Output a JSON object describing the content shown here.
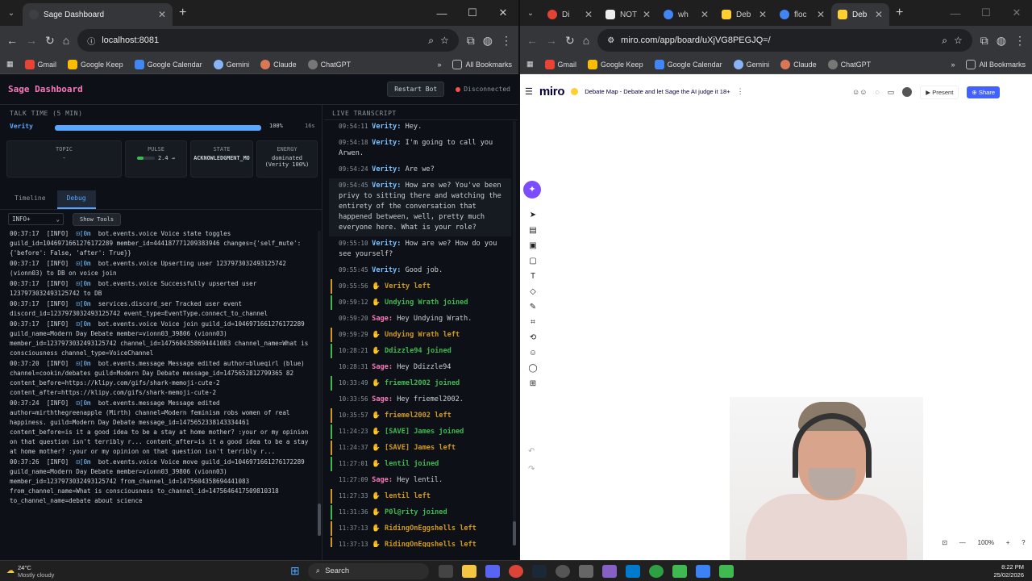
{
  "left_browser": {
    "tab_title": "Sage Dashboard",
    "url": "localhost:8081",
    "bookmarks": [
      "Gmail",
      "Google Keep",
      "Google Calendar",
      "Gemini",
      "Claude",
      "ChatGPT"
    ],
    "all_bookmarks": "All Bookmarks"
  },
  "right_browser": {
    "tabs": [
      "Di",
      "NOT",
      "wh",
      "Deb",
      "floc",
      "Deb"
    ],
    "url": "miro.com/app/board/uXjVG8PEGJQ=/",
    "bookmarks": [
      "Gmail",
      "Google Keep",
      "Google Calendar",
      "Gemini",
      "Claude",
      "ChatGPT"
    ],
    "all_bookmarks": "All Bookmarks"
  },
  "dashboard": {
    "title": "Sage Dashboard",
    "restart_label": "Restart Bot",
    "status": "Disconnected",
    "talk_time_label": "TALK TIME (5 MIN)",
    "talk_speaker": "Verity",
    "talk_percent": "100%",
    "talk_seconds": "16s",
    "talk_fill": 1.0,
    "cards": {
      "topic_label": "TOPIC",
      "topic_value": "-",
      "pulse_label": "PULSE",
      "pulse_value": "2.4 →",
      "state_label": "STATE",
      "state_value": "ACKNOWLEDGMENT_MO",
      "energy_label": "ENERGY",
      "energy_value": "dominated",
      "energy_sub": "(Verity 100%)"
    },
    "tabs": [
      "Timeline",
      "Debug"
    ],
    "filter_value": "INFO+",
    "show_tools": "Show Tools",
    "logs": [
      {
        "time": "00:37:17",
        "level": "[INFO]",
        "mod": "\u001b[0m",
        "msg": "bot.events.voice Voice state toggles guild_id=1046971661276172289 member_id=444187771209383946 changes={'self_mute': {'before': False, 'after': True}}"
      },
      {
        "time": "00:37:17",
        "level": "[INFO]",
        "mod": "\u001b[0m",
        "msg": "bot.events.voice Upserting user 1237973032493125742 (vionn03) to DB on voice join"
      },
      {
        "time": "00:37:17",
        "level": "[INFO]",
        "mod": "\u001b[0m",
        "msg": "bot.events.voice Successfully upserted user 1237973032493125742 to DB"
      },
      {
        "time": "00:37:17",
        "level": "[INFO]",
        "mod": "\u001b[0m",
        "msg": "services.discord_ser Tracked user event discord_id=1237973032493125742 event_type=EventType.connect_to_channel"
      },
      {
        "time": "00:37:17",
        "level": "[INFO]",
        "mod": "\u001b[0m",
        "msg": "bot.events.voice Voice join guild_id=1046971661276172289 guild_name=Modern Day Debate member=vionn03_39806 (vionn03) member_id=1237973032493125742 channel_id=1475604358694441083 channel_name=What is consciousness channel_type=VoiceChannel"
      },
      {
        "time": "00:37:20",
        "level": "[INFO]",
        "mod": "\u001b[0m",
        "msg": "bot.events.message Message edited author=blueqirl (blue) channel=cookin/debates guild=Modern Day Debate message_id=1475652812799365 82 content_before=https://klipy.com/gifs/shark-memoji-cute-2 content_after=https://klipy.com/gifs/shark-memoji-cute-2"
      },
      {
        "time": "00:37:24",
        "level": "[INFO]",
        "mod": "\u001b[0m",
        "msg": "bot.events.message Message edited author=mirththegreenapple (Mirth) channel=Modern feminism robs women of real happiness. guild=Modern Day Debate message_id=1475652338143334461 content_before=is it a good idea to be a stay at home mother? :your or my opinion on that question isn't terribly r... content_after=is it a good idea to be a stay at home mother? :your or my opinion on that question isn't terribly r..."
      },
      {
        "time": "00:37:26",
        "level": "[INFO]",
        "mod": "\u001b[0m",
        "msg": "bot.events.voice Voice move guild_id=1046971661276172289 guild_name=Modern Day Debate member=vionn03_39806 (vionn03) member_id=1237973032493125742 from_channel_id=1475604358694441083 from_channel_name=What is consciousness to_channel_id=1475646417509810318 to_channel_name=debate about science"
      }
    ],
    "transcript_label": "LIVE TRANSCRIPT",
    "transcript": [
      {
        "time": "09:54:11",
        "speaker": "Verity:",
        "text": "Hey.",
        "kind": "speech"
      },
      {
        "time": "09:54:18",
        "speaker": "Verity:",
        "text": "I'm going to call you Arwen.",
        "kind": "speech"
      },
      {
        "time": "09:54:24",
        "speaker": "Verity:",
        "text": "Are we?",
        "kind": "speech"
      },
      {
        "time": "09:54:45",
        "speaker": "Verity:",
        "text": "How are we? You've been privy to sitting there and watching the entirety of the conversation that happened between, well, pretty much everyone here. What is your role?",
        "kind": "speech"
      },
      {
        "time": "09:55:10",
        "speaker": "Verity:",
        "text": "How are we? How do you see yourself?",
        "kind": "speech"
      },
      {
        "time": "09:55:45",
        "speaker": "Verity:",
        "text": "Good job.",
        "kind": "speech"
      },
      {
        "time": "09:55:56",
        "text": "Verity left",
        "kind": "left"
      },
      {
        "time": "09:59:12",
        "text": "Undying Wrath joined",
        "kind": "joined"
      },
      {
        "time": "09:59:20",
        "speaker": "Sage:",
        "text": "Hey Undying Wrath.",
        "kind": "sage"
      },
      {
        "time": "09:59:29",
        "text": "Undying Wrath left",
        "kind": "left"
      },
      {
        "time": "10:28:21",
        "text": "Ddizzle94 joined",
        "kind": "joined"
      },
      {
        "time": "10:28:31",
        "speaker": "Sage:",
        "text": "Hey Ddizzle94",
        "kind": "sage"
      },
      {
        "time": "10:33:49",
        "text": "friemel2002 joined",
        "kind": "joined"
      },
      {
        "time": "10:33:56",
        "speaker": "Sage:",
        "text": "Hey friemel2002.",
        "kind": "sage"
      },
      {
        "time": "10:35:57",
        "text": "friemel2002 left",
        "kind": "left"
      },
      {
        "time": "11:24:23",
        "text": "[SAVE] James joined",
        "kind": "joined"
      },
      {
        "time": "11:24:37",
        "text": "[SAVE] James left",
        "kind": "left"
      },
      {
        "time": "11:27:01",
        "text": "lentil joined",
        "kind": "joined"
      },
      {
        "time": "11:27:09",
        "speaker": "Sage:",
        "text": "Hey lentil.",
        "kind": "sage"
      },
      {
        "time": "11:27:33",
        "text": "lentil left",
        "kind": "left"
      },
      {
        "time": "11:31:36",
        "text": "P0l@rity joined",
        "kind": "joined"
      },
      {
        "time": "11:37:13",
        "text": "RidingOnEggshells left",
        "kind": "left"
      },
      {
        "time": "11:37:13",
        "text": "RidingOnEggshells left",
        "kind": "left"
      }
    ]
  },
  "miro": {
    "logo": "miro",
    "board_title": "Debate Map - Debate and let Sage the AI judge it 18+",
    "present": "Present",
    "share": "Share",
    "zoom": "100%"
  },
  "taskbar": {
    "temp": "24°C",
    "weather": "Mostly cloudy",
    "search": "Search",
    "time": "8:22 PM",
    "date": "25/02/2026"
  },
  "colors": {
    "accent_pink": "#f778ba",
    "accent_blue": "#58a6ff",
    "miro_blue": "#4262ff"
  }
}
